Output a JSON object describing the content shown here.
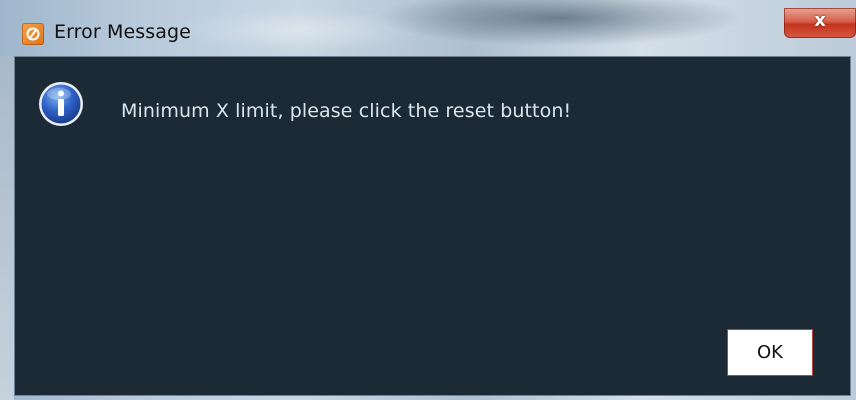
{
  "window": {
    "title": "Error Message",
    "close_label": "x"
  },
  "dialog": {
    "message": "Minimum X limit, please click the reset button!",
    "icon": "info-icon",
    "ok_label": "OK"
  },
  "colors": {
    "client_background": "#1c2a36",
    "ok_border": "#b5453a",
    "close_button": "#c2331d"
  }
}
